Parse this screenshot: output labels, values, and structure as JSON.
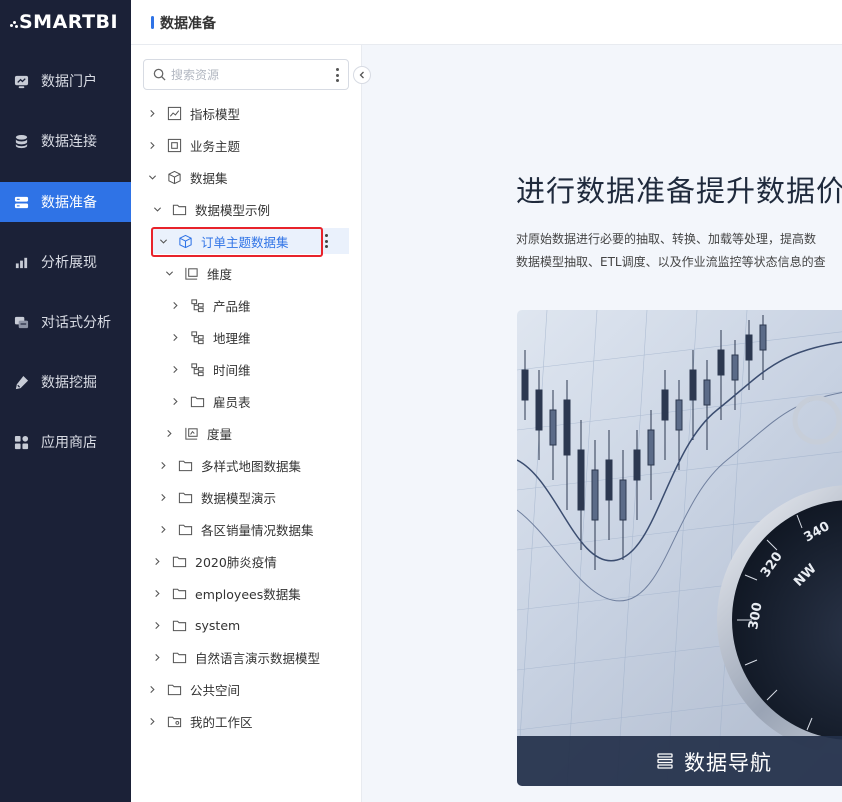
{
  "brand": {
    "logo_text": "SMARTBI"
  },
  "nav": {
    "items": [
      {
        "label": "数据门户",
        "icon": "portal-icon"
      },
      {
        "label": "数据连接",
        "icon": "database-icon"
      },
      {
        "label": "数据准备",
        "icon": "server-icon",
        "active": true
      },
      {
        "label": "分析展现",
        "icon": "bar-chart-icon"
      },
      {
        "label": "对话式分析",
        "icon": "chat-icon"
      },
      {
        "label": "数据挖掘",
        "icon": "pickaxe-icon"
      },
      {
        "label": "应用商店",
        "icon": "apps-icon"
      }
    ]
  },
  "header": {
    "title": "数据准备"
  },
  "search": {
    "placeholder": "搜索资源"
  },
  "tree": [
    {
      "label": "指标模型",
      "icon": "metric-model-icon",
      "expanded": false
    },
    {
      "label": "业务主题",
      "icon": "business-theme-icon",
      "expanded": false
    },
    {
      "label": "数据集",
      "icon": "cube-icon",
      "expanded": true
    },
    {
      "label": "数据模型示例",
      "icon": "folder-icon",
      "expanded": true
    },
    {
      "label": "订单主题数据集",
      "icon": "dataset-cube-icon",
      "expanded": true,
      "selected": true
    },
    {
      "label": "维度",
      "icon": "dimension-icon",
      "expanded": true
    },
    {
      "label": "产品维",
      "icon": "hierarchy-icon",
      "expanded": false
    },
    {
      "label": "地理维",
      "icon": "hierarchy-icon",
      "expanded": false
    },
    {
      "label": "时间维",
      "icon": "hierarchy-icon",
      "expanded": false
    },
    {
      "label": "雇员表",
      "icon": "folder-icon",
      "expanded": false
    },
    {
      "label": "度量",
      "icon": "measure-icon",
      "expanded": false
    },
    {
      "label": "多样式地图数据集",
      "icon": "folder-icon",
      "expanded": false
    },
    {
      "label": "数据模型演示",
      "icon": "folder-icon",
      "expanded": false
    },
    {
      "label": "各区销量情况数据集",
      "icon": "folder-icon",
      "expanded": false
    },
    {
      "label": "2020肺炎疫情",
      "icon": "folder-icon",
      "expanded": false
    },
    {
      "label": "employees数据集",
      "icon": "folder-icon",
      "expanded": false
    },
    {
      "label": "system",
      "icon": "folder-icon",
      "expanded": false
    },
    {
      "label": "自然语言演示数据模型",
      "icon": "folder-icon",
      "expanded": false
    },
    {
      "label": "公共空间",
      "icon": "folder-icon",
      "expanded": false
    },
    {
      "label": "我的工作区",
      "icon": "user-folder-icon",
      "expanded": false
    }
  ],
  "main": {
    "headline": "进行数据准备提升数据价值",
    "description": [
      "对原始数据进行必要的抽取、转换、加载等处理，提高数",
      "数据模型抽取、ETL调度、以及作业流监控等状态信息的查"
    ],
    "nav_button_label": "数据导航"
  },
  "colors": {
    "accent": "#2f73e6",
    "sidebar_bg": "#1b2137",
    "highlight_box": "#e8232b"
  }
}
